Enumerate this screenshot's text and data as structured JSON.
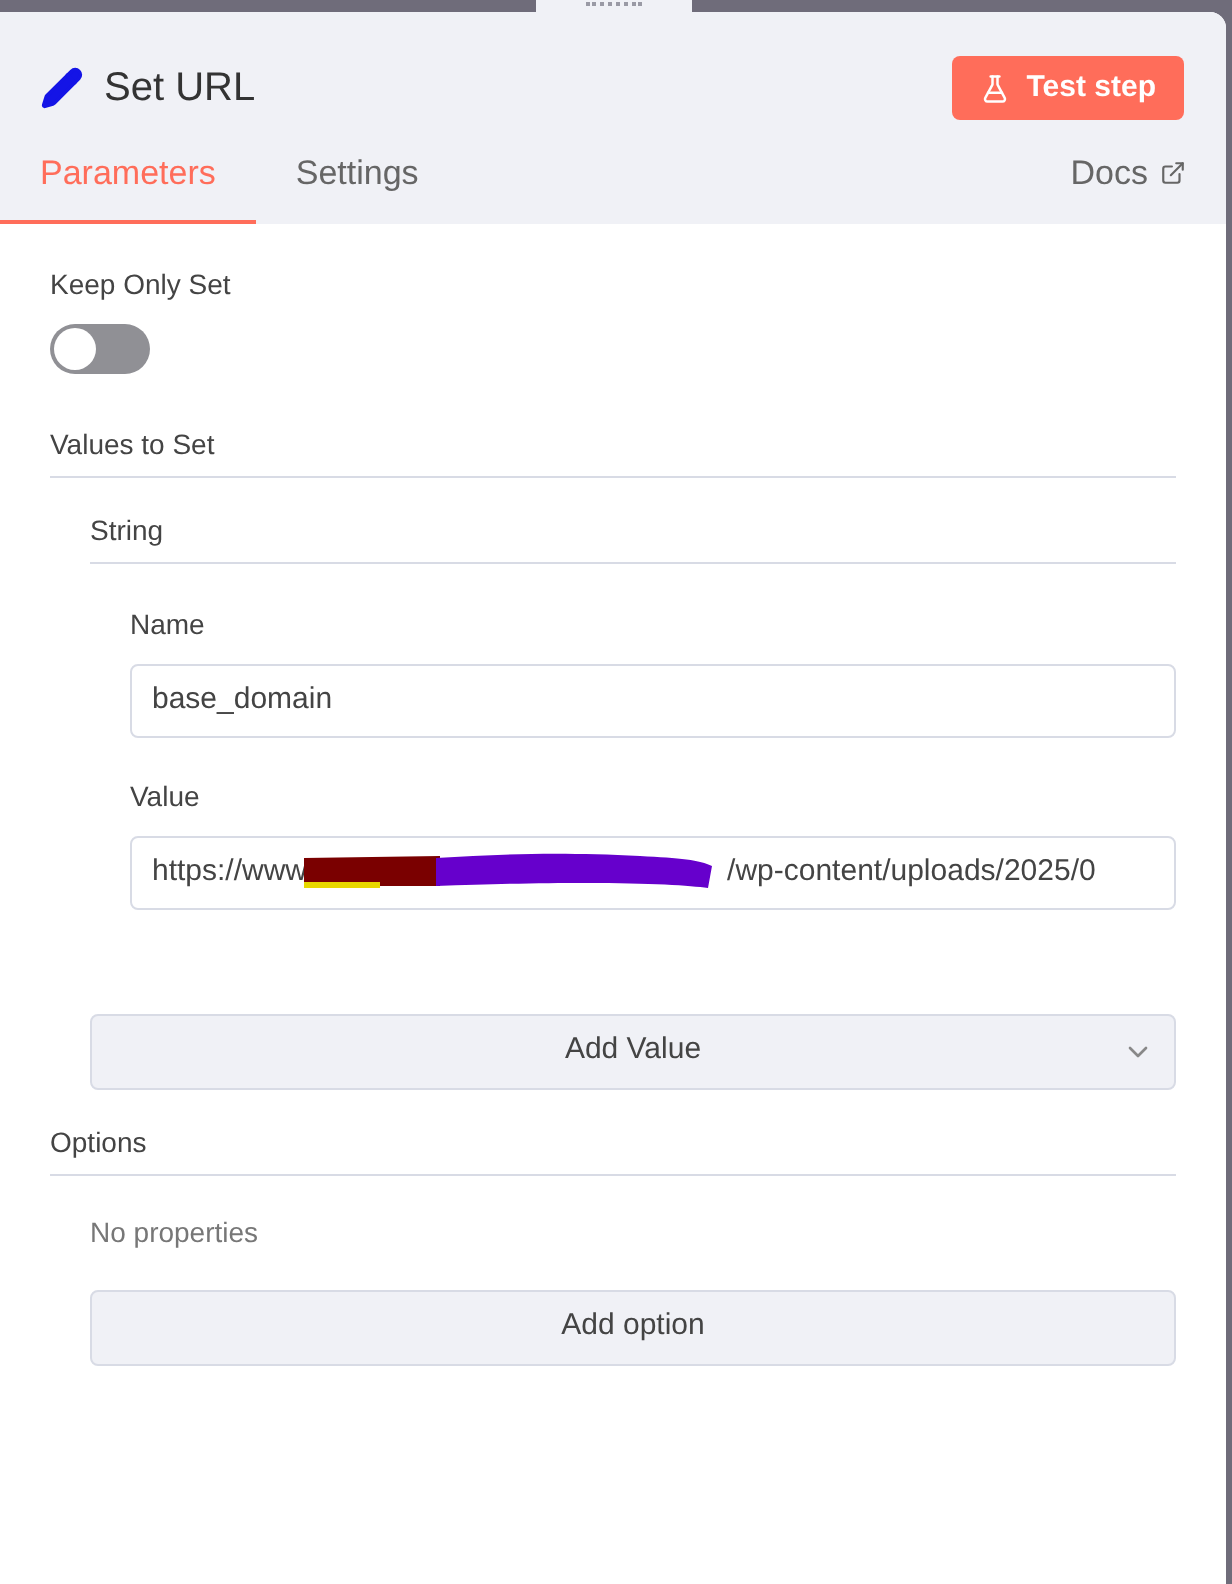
{
  "header": {
    "title": "Set URL",
    "test_button": "Test step"
  },
  "tabs": [
    {
      "label": "Parameters",
      "selected": true
    },
    {
      "label": "Settings",
      "selected": false
    }
  ],
  "docs_link": "Docs",
  "keep_only_set": {
    "label": "Keep Only Set",
    "on": false
  },
  "values_section": {
    "title": "Values to Set",
    "group": "String",
    "fields": [
      {
        "label": "Name",
        "value": "base_domain",
        "redacted": false
      },
      {
        "label": "Value",
        "value": "https://www",
        "value_after_redaction": "/wp-content/uploads/2025/0",
        "redacted": true
      }
    ],
    "add_button": "Add Value"
  },
  "options_section": {
    "title": "Options",
    "empty_text": "No properties",
    "add_button": "Add option"
  }
}
